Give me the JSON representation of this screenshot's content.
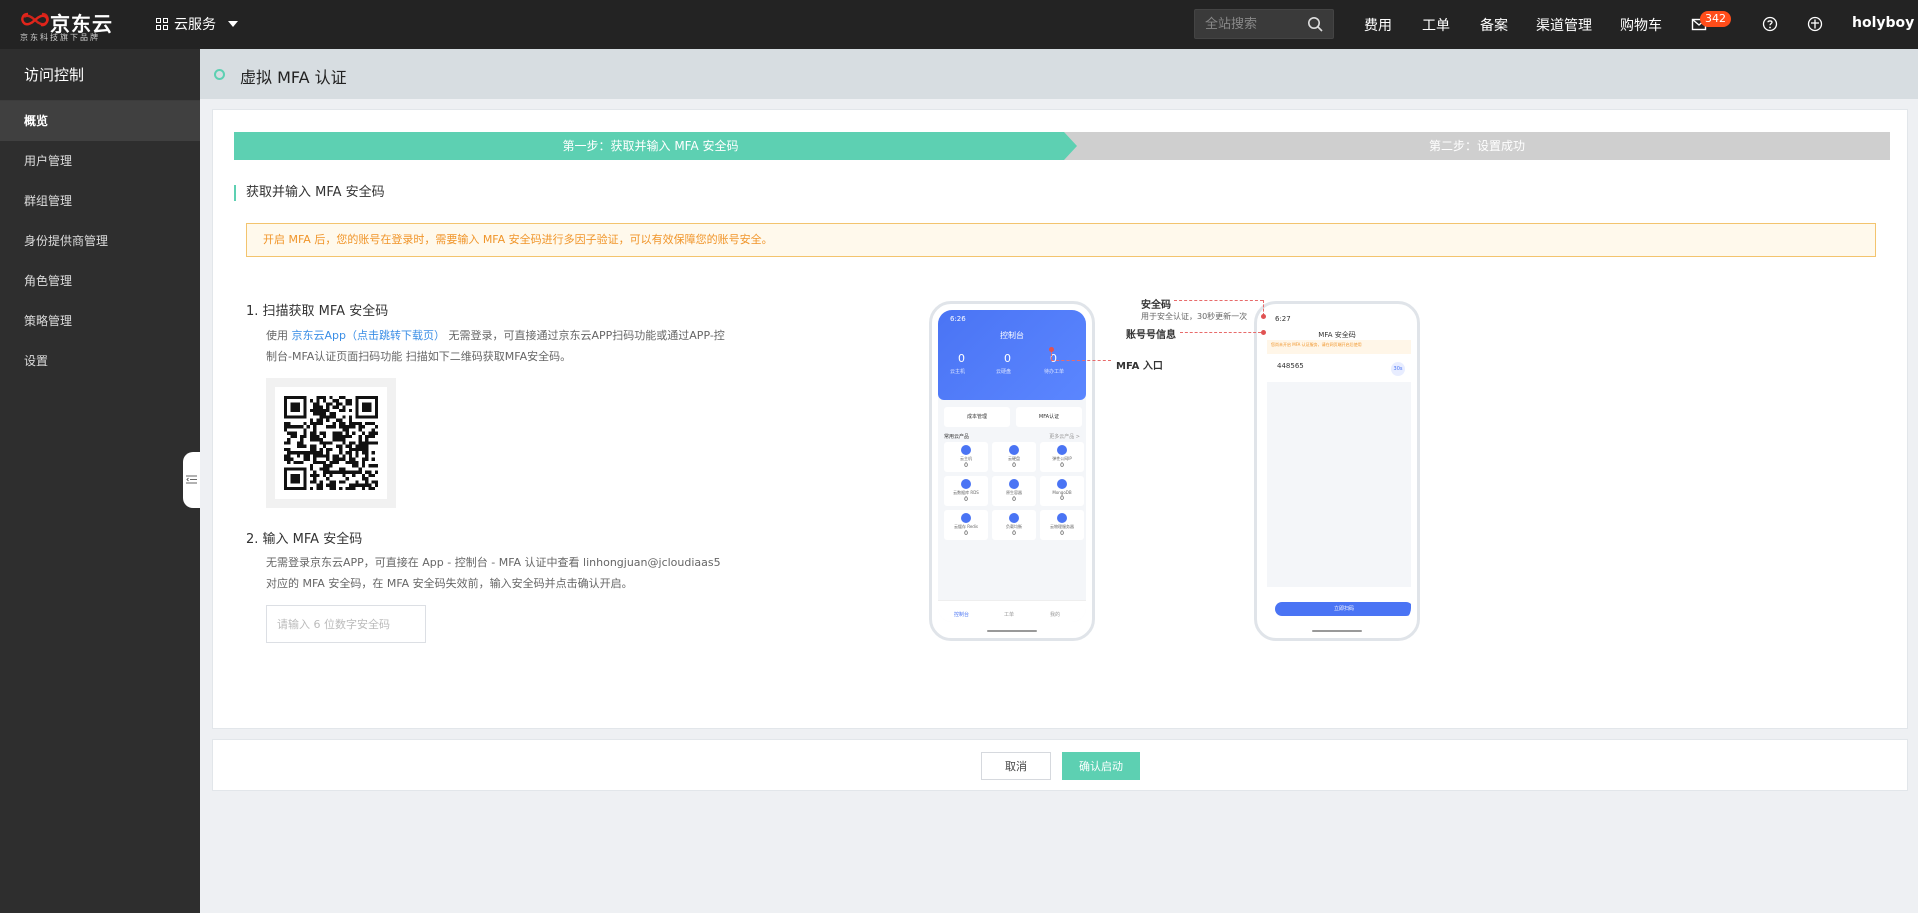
{
  "brand": {
    "name": "京东云",
    "tagline": "京东科技旗下品牌",
    "accent_color": "#e1251b"
  },
  "topbar": {
    "cloud_services_label": "云服务",
    "search_placeholder": "全站搜索",
    "nav": [
      "费用",
      "工单",
      "备案",
      "渠道管理",
      "购物车"
    ],
    "mail_badge": "342",
    "username": "holyboy"
  },
  "sidebar": {
    "title": "访问控制",
    "items": [
      {
        "label": "概览",
        "active": true
      },
      {
        "label": "用户管理"
      },
      {
        "label": "群组管理"
      },
      {
        "label": "身份提供商管理"
      },
      {
        "label": "角色管理"
      },
      {
        "label": "策略管理"
      },
      {
        "label": "设置"
      }
    ]
  },
  "page": {
    "title": "虚拟 MFA 认证",
    "accent_color": "#5dd0b2"
  },
  "steps": {
    "step1": "第一步：获取并输入 MFA 安全码",
    "step2": "第二步：设置成功"
  },
  "section": {
    "title": "获取并输入 MFA 安全码",
    "alert": "开启 MFA 后，您的账号在登录时，需要输入 MFA 安全码进行多因子验证，可以有效保障您的账号安全。"
  },
  "scan": {
    "heading": "1. 扫描获取 MFA 安全码",
    "desc_prefix": "使用 ",
    "desc_link": "京东云App（点击跳转下载页）",
    "desc_mid": " 无需登录，可直接通过京东云APP扫码功能或通过APP-控",
    "desc_line2": "制台-MFA认证页面扫码功能 扫描如下二维码获取MFA安全码。"
  },
  "enter": {
    "heading": "2. 输入 MFA 安全码",
    "desc_line1": "无需登录京东云APP，可直接在 App - 控制台 - MFA 认证中查看 linhongjuan@jcloudiaas5",
    "desc_line2": "对应的 MFA 安全码，在 MFA 安全码失效前，输入安全码并点击确认开启。",
    "input_placeholder": "请输入 6 位数字安全码",
    "input_value": ""
  },
  "phone1": {
    "time": "6:26",
    "title": "控制台",
    "stats": [
      "0",
      "0",
      "0"
    ],
    "stat_labels": [
      "云主机",
      "云硬盘",
      "待办工单"
    ],
    "shortcut_left": "成本管理",
    "shortcut_right": "MFA认证",
    "section_title": "常用云产品",
    "section_more": "更多云产品 >",
    "products": [
      {
        "name": "云主机",
        "count": "0"
      },
      {
        "name": "云硬盘",
        "count": "0"
      },
      {
        "name": "弹性公网IP",
        "count": "0"
      },
      {
        "name": "云数据库 RDS",
        "count": "0"
      },
      {
        "name": "原生容器",
        "count": "0"
      },
      {
        "name": "MongoDB",
        "count": "0"
      },
      {
        "name": "云缓存 Redis",
        "count": "0"
      },
      {
        "name": "负载均衡",
        "count": "0"
      },
      {
        "name": "云物理服务器",
        "count": "0"
      }
    ],
    "tabs": [
      "控制台",
      "工单",
      "我的"
    ]
  },
  "phone2": {
    "time": "6:27",
    "title": "MFA 安全码",
    "notice": "您尚未开启 MFA 认证服务，请在网页端开启后使用",
    "code": "448565",
    "countdown": "30s",
    "button": "立即扫码"
  },
  "annotations": {
    "security_code": "安全码",
    "security_code_desc": "用于安全认证，30秒更新一次",
    "account_info": "账号号信息",
    "mfa_entry": "MFA 入口"
  },
  "footer": {
    "cancel": "取消",
    "confirm": "确认启动"
  }
}
